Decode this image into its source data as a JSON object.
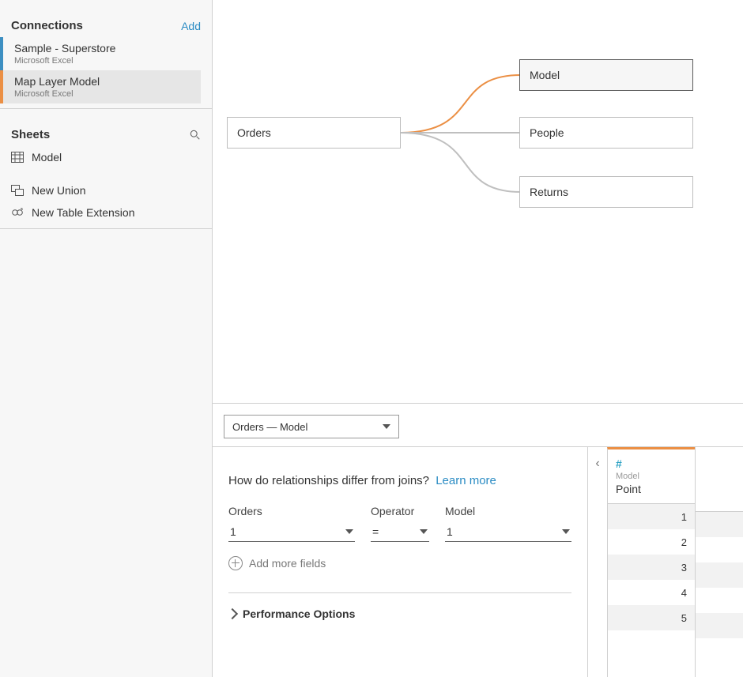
{
  "sidebar": {
    "connections_title": "Connections",
    "add_label": "Add",
    "connections": [
      {
        "name": "Sample - Superstore",
        "sub": "Microsoft Excel"
      },
      {
        "name": "Map Layer Model",
        "sub": "Microsoft Excel"
      }
    ],
    "sheets_title": "Sheets",
    "sheets": [
      {
        "label": "Model"
      }
    ],
    "new_union": "New Union",
    "new_ext": "New Table Extension"
  },
  "canvas": {
    "nodes": {
      "orders": "Orders",
      "model": "Model",
      "people": "People",
      "returns": "Returns"
    }
  },
  "relbar": {
    "selected": "Orders  —  Model"
  },
  "editor": {
    "question": "How do relationships differ from joins?",
    "learn_more": "Learn more",
    "orders_label": "Orders",
    "operator_label": "Operator",
    "model_label": "Model",
    "orders_value": "1",
    "operator_value": "=",
    "model_value": "1",
    "add_more": "Add more fields",
    "perf": "Performance Options"
  },
  "preview": {
    "type_icon": "#",
    "source": "Model",
    "field": "Point",
    "rows": [
      "1",
      "2",
      "3",
      "4",
      "5"
    ]
  }
}
